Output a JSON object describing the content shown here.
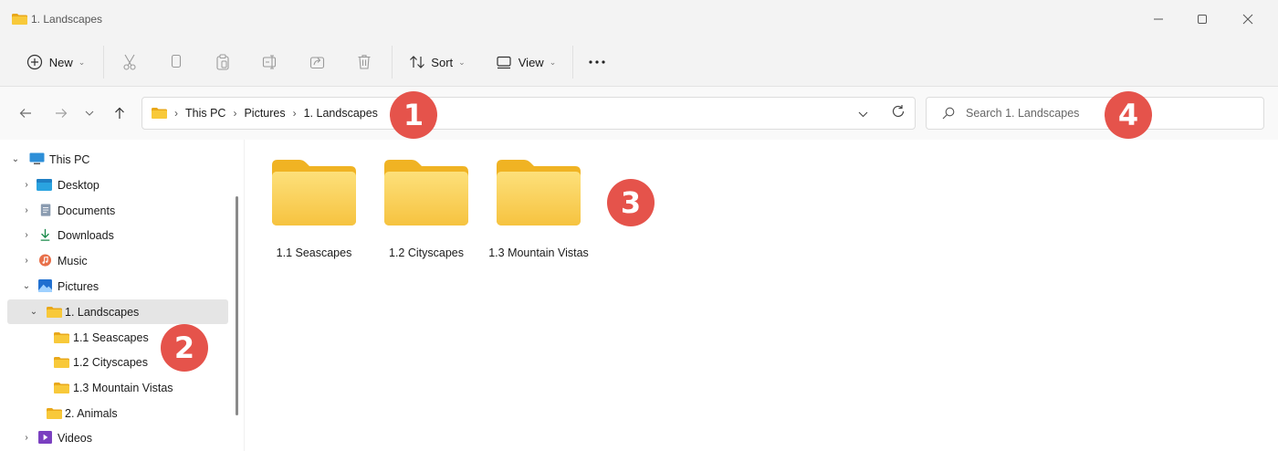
{
  "window": {
    "title": "1. Landscapes"
  },
  "toolbar": {
    "new_label": "New",
    "sort_label": "Sort",
    "view_label": "View"
  },
  "address": {
    "crumbs": [
      "This PC",
      "Pictures",
      "1. Landscapes"
    ]
  },
  "search": {
    "placeholder": "Search 1. Landscapes"
  },
  "sidebar": {
    "items": [
      {
        "label": "This PC",
        "icon": "monitor-icon"
      },
      {
        "label": "Desktop",
        "icon": "desktop-icon"
      },
      {
        "label": "Documents",
        "icon": "documents-icon"
      },
      {
        "label": "Downloads",
        "icon": "download-icon"
      },
      {
        "label": "Music",
        "icon": "music-icon"
      },
      {
        "label": "Pictures",
        "icon": "pictures-icon"
      },
      {
        "label": "1. Landscapes",
        "icon": "folder-icon"
      },
      {
        "label": "1.1 Seascapes",
        "icon": "folder-icon"
      },
      {
        "label": "1.2 Cityscapes",
        "icon": "folder-icon"
      },
      {
        "label": "1.3 Mountain Vistas",
        "icon": "folder-icon"
      },
      {
        "label": "2. Animals",
        "icon": "folder-icon"
      },
      {
        "label": "Videos",
        "icon": "video-icon"
      }
    ]
  },
  "content": {
    "folders": [
      {
        "name": "1.1 Seascapes"
      },
      {
        "name": "1.2 Cityscapes"
      },
      {
        "name": "1.3 Mountain Vistas"
      }
    ]
  },
  "callouts": [
    "1",
    "2",
    "3",
    "4"
  ],
  "colors": {
    "accent": "#0067c0",
    "callout": "#e5534b",
    "folder": "#f8c93a"
  }
}
